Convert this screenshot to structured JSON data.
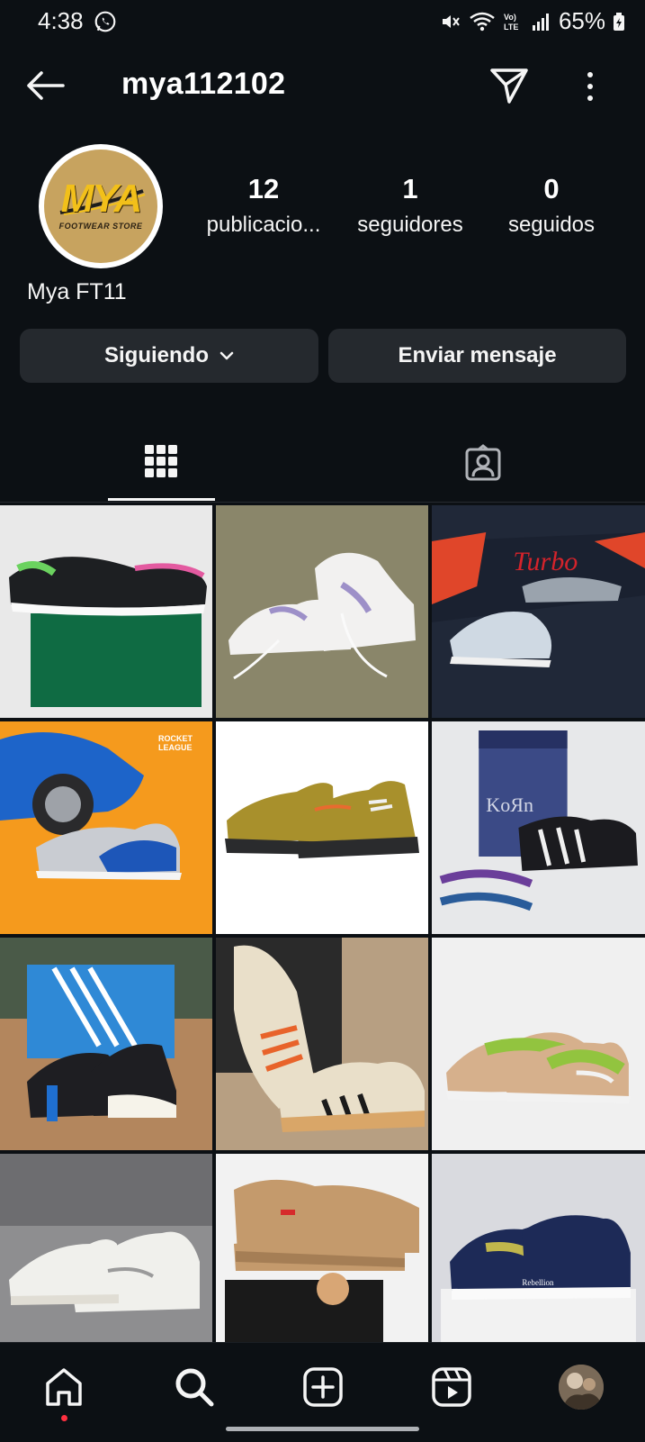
{
  "status_bar": {
    "time": "4:38",
    "battery": "65%"
  },
  "header": {
    "username": "mya112102"
  },
  "profile": {
    "display_name": "Mya FT11",
    "logo_text": "MYA",
    "logo_subtext": "FOOTWEAR STORE",
    "stats": [
      {
        "count": "12",
        "label": "publicacio..."
      },
      {
        "count": "1",
        "label": "seguidores"
      },
      {
        "count": "0",
        "label": "seguidos"
      }
    ]
  },
  "actions": {
    "following": "Siguiendo",
    "message": "Enviar mensaje"
  },
  "tabs": {
    "active": "grid-icon",
    "items": [
      "grid-icon",
      "tagged-icon"
    ]
  },
  "posts": [
    {
      "icon": "puma-rs-sneakers-photo",
      "colors": [
        "#e9e9e9",
        "#0f6b43"
      ]
    },
    {
      "icon": "white-lilac-sneakers-photo",
      "colors": [
        "#8a866a",
        "#f2f1f0"
      ]
    },
    {
      "icon": "turbo-sneaker-photo",
      "colors": [
        "#202838",
        "#cfd9e3"
      ]
    },
    {
      "icon": "rocket-league-puma-photo",
      "colors": [
        "#f59a1d",
        "#1d56b8"
      ]
    },
    {
      "icon": "olive-hiking-sneakers-photo",
      "colors": [
        "#ffffff",
        "#a8902c"
      ]
    },
    {
      "icon": "korn-adidas-campus-photo",
      "colors": [
        "#e7e8ea",
        "#1b1b1f"
      ]
    },
    {
      "icon": "adidas-superstar-photo",
      "colors": [
        "#b3865d",
        "#1e1e22"
      ]
    },
    {
      "icon": "adidas-beige-sneakers-photo",
      "colors": [
        "#b79f82",
        "#e9dfc9"
      ]
    },
    {
      "icon": "nike-dunk-green-photo",
      "colors": [
        "#f0f0f0",
        "#92c43f"
      ]
    },
    {
      "icon": "white-air-force-photo",
      "colors": [
        "#8e8e90",
        "#f0f0ec"
      ]
    },
    {
      "icon": "wheat-air-force-photo",
      "colors": [
        "#f2f2f2",
        "#c49a6c"
      ]
    },
    {
      "icon": "navy-dunk-photo",
      "colors": [
        "#d9dadf",
        "#1d2a57"
      ]
    }
  ],
  "bottom_nav": [
    "home-icon",
    "search-icon",
    "create-icon",
    "reels-icon",
    "profile-avatar"
  ]
}
